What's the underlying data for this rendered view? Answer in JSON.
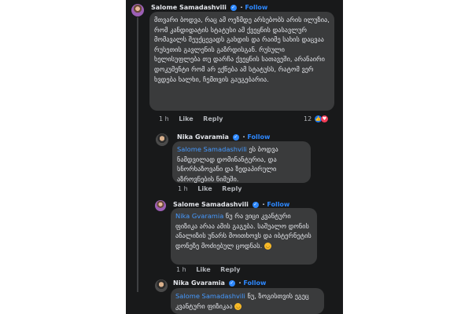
{
  "comments": [
    {
      "author": "Salome Samadashvili",
      "follow": "Follow",
      "text": "მთვარი ბოდვა, რაც ამ ოეზმდე არსებობს არის ილუზია, რომ კანდიდატის სტატუსი ამ ქვეყნის დასავლურ მომავალს შეუქცევადს გახდის და რაიმე სახის დაცვაა რუსეთის გავლენის გაზრდისგან. რუსული ხელისუფლება თუ დარჩა ქვეყნის სათავეში, არანაირი დოკუმენტი რომ არ ექნება ამ სტატუსს, რატომ ვერ ხვდება ხალხი, ჩემთვის გაუგებარია.",
      "time": "1 h",
      "like": "Like",
      "reply": "Reply",
      "reaction_count": "12"
    },
    {
      "author": "Nika Gvaramia",
      "follow": "Follow",
      "mention": "Salome Samadashvili",
      "text": " ეს ბოდვა ნამდვილად დომინანტურია, და სნორხაზოვანი და ზედაპირული აზროვნების ნიმუში.",
      "time": "1 h",
      "like": "Like",
      "reply": "Reply"
    },
    {
      "author": "Salome Samadashvili",
      "follow": "Follow",
      "mention": "Nika Gvaramia",
      "text": " ნუ რა ვიცი კვანტური ფიზიკა არაა ამის გაგება. საშუალო დონის ანალიზის უნარს მოითხოვს და იბტერნეტის დონეზე მოძიებულ ცოდნას.",
      "time": "1 h",
      "like": "Like",
      "reply": "Reply"
    },
    {
      "author": "Nika Gvaramia",
      "follow": "Follow",
      "mention": "Salome Samadashvili",
      "text": " ნუ, ზოგისთვის ეგეც კვანტური ფიზიკაა",
      "time": "1 h",
      "like": "Like",
      "reply": "Reply"
    }
  ],
  "colors": {
    "panel_bg": "#18191a",
    "bubble_bg": "#3a3b3c",
    "text": "#e4e6eb",
    "muted": "#b0b3b8",
    "accent": "#2d88ff"
  },
  "icons": [
    "verified-badge-icon",
    "like-reaction-icon",
    "love-reaction-icon",
    "laughing-emoji-icon"
  ]
}
